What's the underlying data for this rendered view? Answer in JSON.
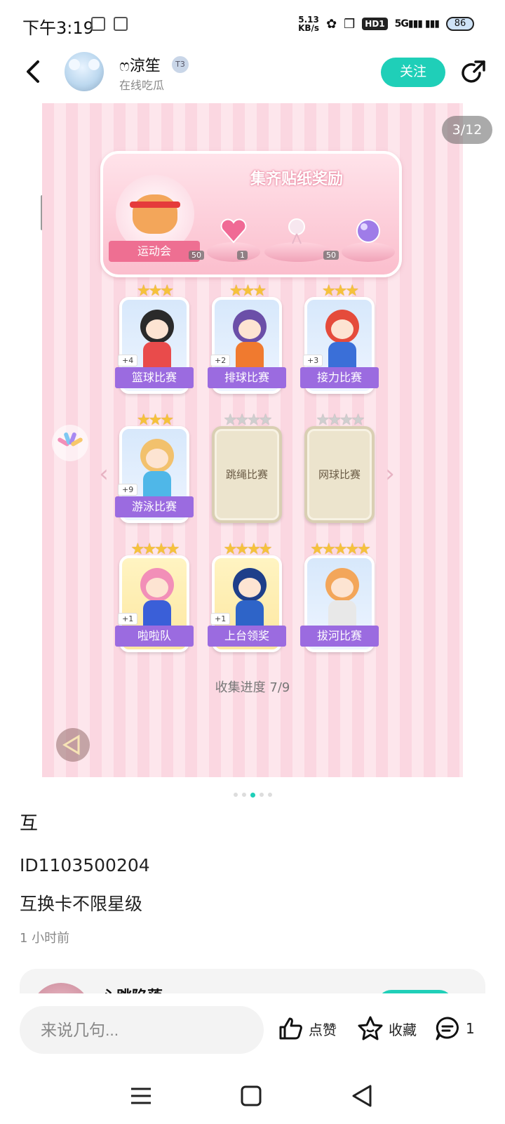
{
  "status_bar": {
    "time": "下午3:19",
    "net_speed_value": "5.13",
    "net_speed_unit": "KB/s",
    "hd": "HD1",
    "signal": "5G",
    "battery": "86"
  },
  "header": {
    "user_name": "ෆ涼笙",
    "user_level": "T3",
    "user_status": "在线吃瓜",
    "follow_label": "关注"
  },
  "image": {
    "page_counter": "3/12",
    "banner_title": "集齐贴纸奖励",
    "banner_label": "运动会",
    "rewards": [
      {
        "name": "pink-heart-gem",
        "count": "50"
      },
      {
        "name": "crystal-bouquet",
        "count": "1"
      },
      {
        "name": "purple-orb",
        "count": "50"
      }
    ],
    "cards": [
      {
        "label": "篮球比赛",
        "stars": "★★★",
        "plus": "+4",
        "collected": true,
        "head": "#2a2a2a",
        "body": "#e94b4b",
        "bg": "blue"
      },
      {
        "label": "排球比赛",
        "stars": "★★★",
        "plus": "+2",
        "collected": true,
        "head": "#6b4fa8",
        "body": "#f07a2f",
        "bg": "blue"
      },
      {
        "label": "接力比赛",
        "stars": "★★★",
        "plus": "+3",
        "collected": true,
        "head": "#e54b3b",
        "body": "#3a6fd8",
        "bg": "blue"
      },
      {
        "label": "游泳比赛",
        "stars": "★★★",
        "plus": "+9",
        "collected": true,
        "head": "#f2c16d",
        "body": "#4fb7e8",
        "bg": "blue"
      },
      {
        "label": "跳绳比赛",
        "stars": "★★★★",
        "plus": "",
        "collected": false
      },
      {
        "label": "网球比赛",
        "stars": "★★★★",
        "plus": "",
        "collected": false
      },
      {
        "label": "啦啦队",
        "stars": "★★★★",
        "plus": "+1",
        "collected": true,
        "head": "#f28fb8",
        "body": "#3a5fd8",
        "bg": "gold"
      },
      {
        "label": "上台领奖",
        "stars": "★★★★",
        "plus": "+1",
        "collected": true,
        "head": "#1e3f8a",
        "body": "#2e64c8",
        "bg": "gold"
      },
      {
        "label": "拔河比赛",
        "stars": "★★★★★",
        "plus": "",
        "collected": true,
        "head": "#f3a65a",
        "body": "#e8e8e8",
        "bg": "blue"
      }
    ],
    "progress_label": "收集进度",
    "progress_value": "7/9",
    "progress_fraction": 0.7778
  },
  "pager": {
    "count": 5,
    "active_index": 2
  },
  "post": {
    "title": "互",
    "line1": "ID1103500204",
    "line2": "互换卡不限星级",
    "time": "1 小时前"
  },
  "next_post": {
    "user_name": "心跳陷落"
  },
  "bottom_bar": {
    "comment_placeholder": "来说几句...",
    "like_label": "点赞",
    "collect_label": "收藏",
    "comment_count": "1"
  },
  "colors": {
    "accent": "#1fcfb8",
    "card_label": "#9b6be0",
    "star_gold": "#f6c23b",
    "stripe_pink": "#fbd7e1"
  }
}
